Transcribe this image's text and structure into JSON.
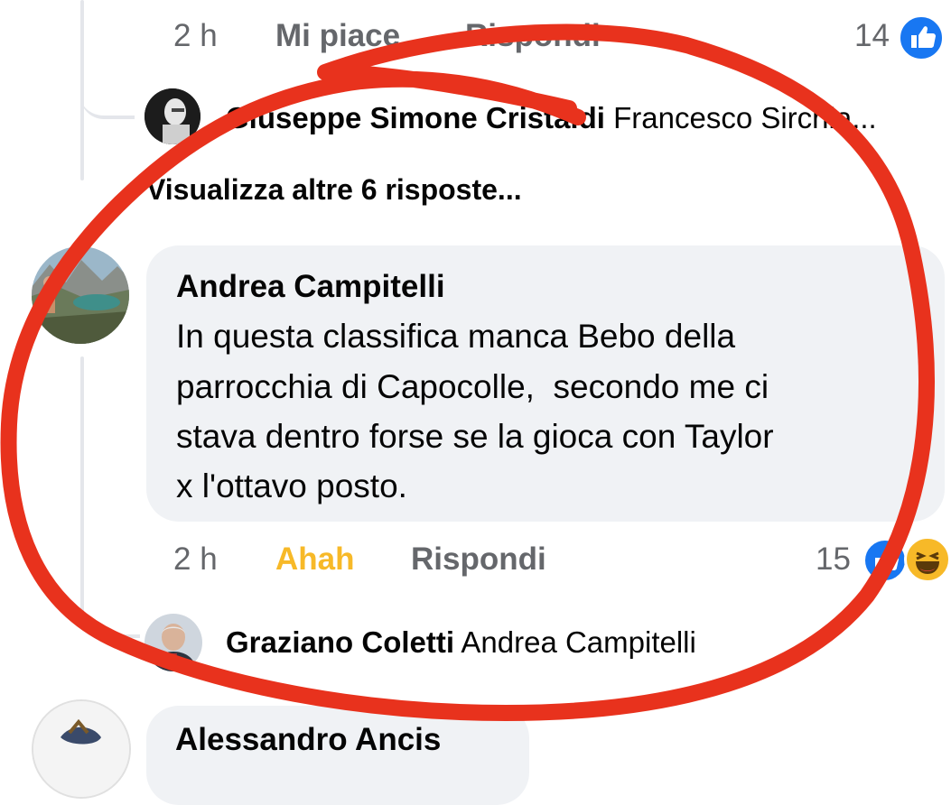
{
  "colors": {
    "like_blue": "#1877f2",
    "haha_yellow": "#f7b928",
    "annotation_red": "#e8321d",
    "bubble_bg": "#f0f2f5",
    "meta_gray": "#65676b"
  },
  "top_comment_meta": {
    "time": "2 h",
    "like_label": "Mi piace",
    "reply_label": "Rispondi",
    "reaction_count": "14",
    "reaction_icons": [
      "like-icon"
    ]
  },
  "reply_preview_1": {
    "author": "Giuseppe Simone Cristaldi",
    "tag": "Francesco Sirchia..."
  },
  "view_more_replies": "Visualizza altre 6 risposte...",
  "main_comment": {
    "author": "Andrea Campitelli",
    "text_lines": [
      "In questa classifica manca Bebo della",
      "parrocchia di Capocolle,  secondo me ci",
      "stava dentro forse se la gioca con Taylor",
      "x l'ottavo posto."
    ],
    "time": "2 h",
    "reaction_label": "Ahah",
    "reply_label": "Rispondi",
    "reaction_count": "15",
    "reaction_icons": [
      "like-icon",
      "haha-icon"
    ]
  },
  "reply_preview_2": {
    "author": "Graziano Coletti",
    "tag": "Andrea Campitelli"
  },
  "next_comment": {
    "author": "Alessandro Ancis"
  }
}
